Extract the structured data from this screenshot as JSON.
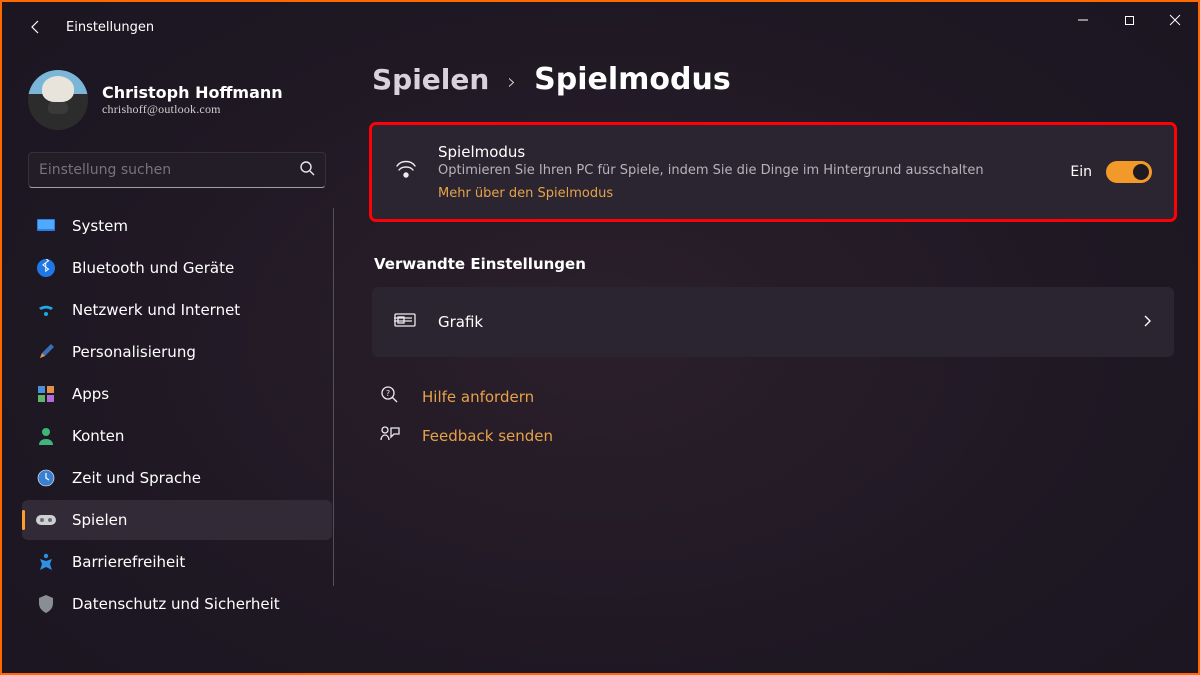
{
  "app_title": "Einstellungen",
  "profile": {
    "name": "Christoph Hoffmann",
    "email": "chrishoff@outlook.com"
  },
  "search": {
    "placeholder": "Einstellung suchen"
  },
  "sidebar": {
    "items": [
      {
        "label": "System"
      },
      {
        "label": "Bluetooth und Geräte"
      },
      {
        "label": "Netzwerk und Internet"
      },
      {
        "label": "Personalisierung"
      },
      {
        "label": "Apps"
      },
      {
        "label": "Konten"
      },
      {
        "label": "Zeit und Sprache"
      },
      {
        "label": "Spielen"
      },
      {
        "label": "Barrierefreiheit"
      },
      {
        "label": "Datenschutz und Sicherheit"
      }
    ]
  },
  "breadcrumb": {
    "parent": "Spielen",
    "current": "Spielmodus"
  },
  "gamemode": {
    "title": "Spielmodus",
    "subtitle": "Optimieren Sie Ihren PC für Spiele, indem Sie die Dinge im Hintergrund ausschalten",
    "link": "Mehr über den Spielmodus",
    "state_label": "Ein"
  },
  "related": {
    "heading": "Verwandte Einstellungen",
    "graphics": "Grafik"
  },
  "links": {
    "help": "Hilfe anfordern",
    "feedback": "Feedback senden"
  }
}
